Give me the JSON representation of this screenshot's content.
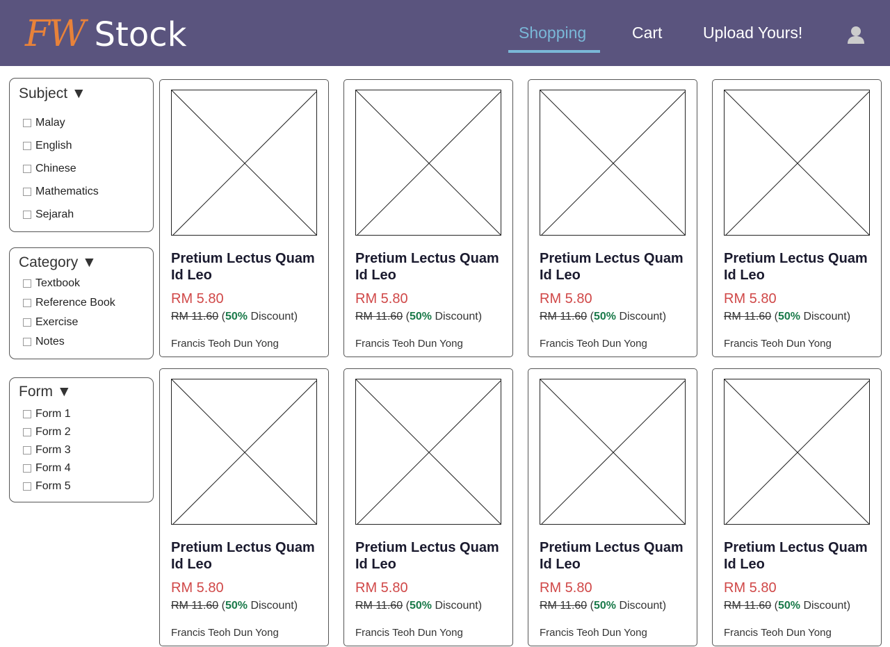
{
  "header": {
    "logo_fw": "FW",
    "logo_stock": "Stock",
    "nav": [
      "Shopping",
      "Cart",
      "Upload Yours!"
    ],
    "active_nav": "Shopping",
    "user_icon": "user-icon",
    "colors": {
      "bar": "#5a547e",
      "logo_accent": "#e8823a",
      "active": "#7ab8d8"
    }
  },
  "filters": {
    "subject": {
      "title": "Subject ▼",
      "options": [
        "Malay",
        "English",
        "Chinese",
        "Mathematics",
        "Sejarah"
      ]
    },
    "category": {
      "title": "Category ▼",
      "options": [
        "Textbook",
        "Reference Book",
        "Exercise",
        "Notes"
      ]
    },
    "form": {
      "title": "Form ▼",
      "options": [
        "Form 1",
        "Form 2",
        "Form 3",
        "Form 4",
        "Form 5"
      ]
    }
  },
  "products": [
    {
      "title": "Pretium Lectus Quam Id Leo",
      "price": "RM 5.80",
      "original": "RM 11.60",
      "open": " (",
      "discount": "50%",
      "discount_suffix": " Discount)",
      "author": "Francis Teoh Dun Yong",
      "image": "placeholder-image-icon"
    },
    {
      "title": "Pretium Lectus Quam Id Leo",
      "price": "RM 5.80",
      "original": "RM 11.60",
      "open": " (",
      "discount": "50%",
      "discount_suffix": " Discount)",
      "author": "Francis Teoh Dun Yong",
      "image": "placeholder-image-icon"
    },
    {
      "title": "Pretium Lectus Quam Id Leo",
      "price": "RM 5.80",
      "original": "RM 11.60",
      "open": " (",
      "discount": "50%",
      "discount_suffix": " Discount)",
      "author": "Francis Teoh Dun Yong",
      "image": "placeholder-image-icon"
    },
    {
      "title": "Pretium Lectus Quam Id Leo",
      "price": "RM 5.80",
      "original": "RM 11.60",
      "open": " (",
      "discount": "50%",
      "discount_suffix": " Discount)",
      "author": "Francis Teoh Dun Yong",
      "image": "placeholder-image-icon"
    },
    {
      "title": "Pretium Lectus Quam Id Leo",
      "price": "RM 5.80",
      "original": "RM 11.60",
      "open": " (",
      "discount": "50%",
      "discount_suffix": " Discount)",
      "author": "Francis Teoh Dun Yong",
      "image": "placeholder-image-icon"
    },
    {
      "title": "Pretium Lectus Quam Id Leo",
      "price": "RM 5.80",
      "original": "RM 11.60",
      "open": " (",
      "discount": "50%",
      "discount_suffix": " Discount)",
      "author": "Francis Teoh Dun Yong",
      "image": "placeholder-image-icon"
    },
    {
      "title": "Pretium Lectus Quam Id Leo",
      "price": "RM 5.80",
      "original": "RM 11.60",
      "open": " (",
      "discount": "50%",
      "discount_suffix": " Discount)",
      "author": "Francis Teoh Dun Yong",
      "image": "placeholder-image-icon"
    },
    {
      "title": "Pretium Lectus Quam Id Leo",
      "price": "RM 5.80",
      "original": "RM 11.60",
      "open": " (",
      "discount": "50%",
      "discount_suffix": " Discount)",
      "author": "Francis Teoh Dun Yong",
      "image": "placeholder-image-icon"
    }
  ]
}
